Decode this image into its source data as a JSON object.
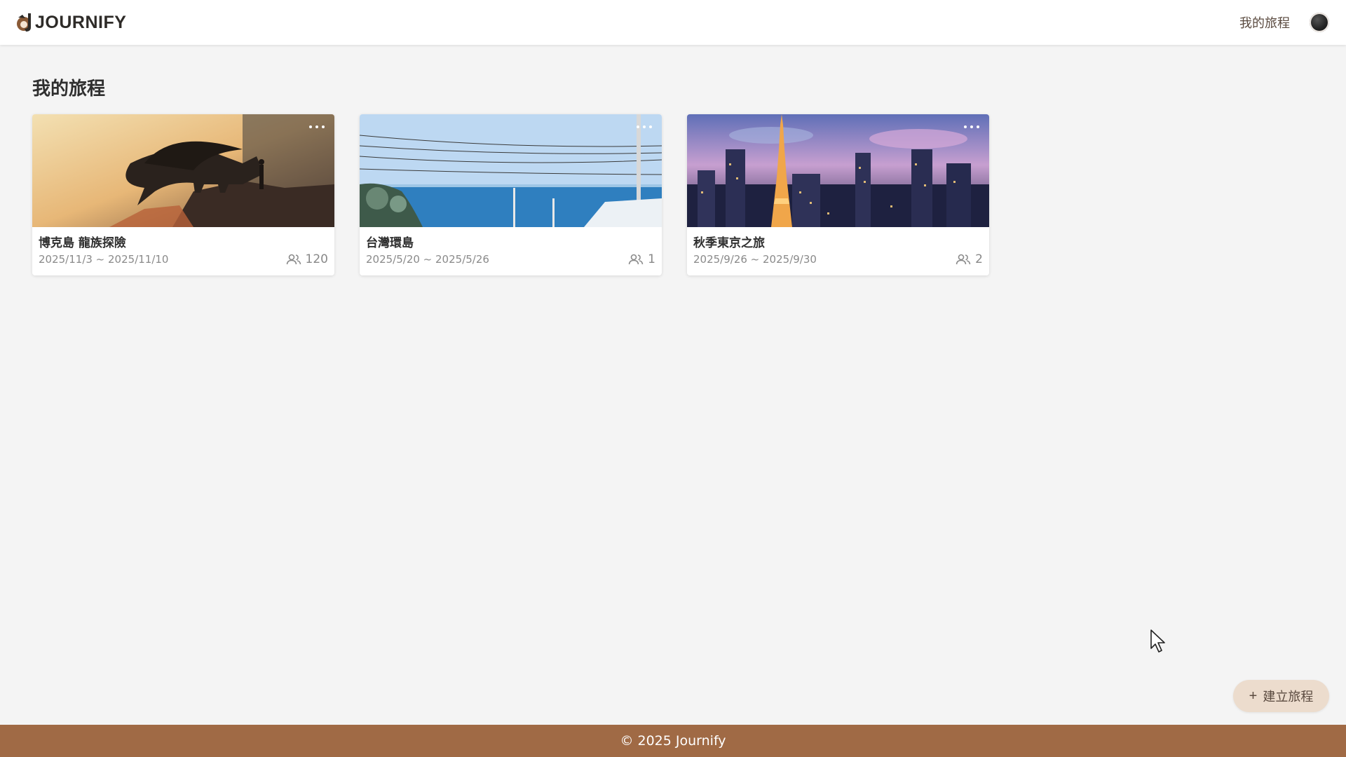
{
  "header": {
    "brand": "JOURNIFY",
    "nav_link": "我的旅程"
  },
  "main": {
    "title": "我的旅程",
    "trips": [
      {
        "title": "博克島 龍族探險",
        "dates": "2025/11/3 ~ 2025/11/10",
        "count": "120"
      },
      {
        "title": "台灣環島",
        "dates": "2025/5/20 ~ 2025/5/26",
        "count": "1"
      },
      {
        "title": "秋季東京之旅",
        "dates": "2025/9/26 ~ 2025/9/30",
        "count": "2"
      }
    ]
  },
  "fab": {
    "label": "建立旅程",
    "icon": "plus-icon"
  },
  "footer": {
    "text": "© 2025 Journify"
  },
  "colors": {
    "footer_bg": "#a06a45",
    "fab_bg": "#ecdccd",
    "page_bg": "#f4f4f4"
  }
}
